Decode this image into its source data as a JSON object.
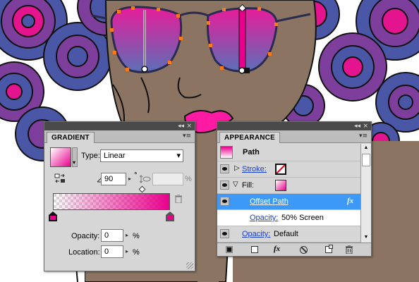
{
  "gradient_panel": {
    "tab_label": "GRADIENT",
    "type_label": "Type:",
    "type_value": "Linear",
    "angle_value": "90",
    "angle_unit": "°",
    "aspect_unit": "%",
    "opacity_label": "Opacity:",
    "opacity_value": "0",
    "opacity_unit": "%",
    "location_label": "Location:",
    "location_value": "0",
    "location_unit": "%",
    "gradient_start_color": "#ffffff",
    "gradient_end_color": "#e8008c",
    "collapse_glyph": "◂◂",
    "close_glyph": "×",
    "menu_glyph": "▾≡",
    "type_dropdown_glyph": "▾",
    "spin_glyph": "▸",
    "icons": [
      "gradient-swatch-icon",
      "reverse-gradient-icon",
      "angle-icon",
      "aspect-ratio-icon",
      "delete-stop-icon",
      "color-stop-icon",
      "midpoint-icon"
    ]
  },
  "appearance_panel": {
    "tab_label": "APPEARANCE",
    "path_label": "Path",
    "stroke_label": "Stroke:",
    "fill_label": "Fill:",
    "offset_path_label": "Offset Path",
    "fx_label": "fx",
    "opacity_link": "Opacity:",
    "opacity_value": "50% Screen",
    "bottom_opacity_link": "Opacity:",
    "bottom_opacity_value": "Default",
    "selected_color": "#3d99f5",
    "collapse_glyph": "◂◂",
    "close_glyph": "×",
    "menu_glyph": "▾≡",
    "footer_icons": [
      "new-art-icon",
      "add-stroke-icon",
      "add-fill-icon",
      "add-effect-icon",
      "clear-appearance-icon",
      "duplicate-item-icon",
      "delete-item-icon"
    ]
  },
  "artwork": {
    "skin_color": "#8b7462",
    "hair_colors": [
      "#4a56a6",
      "#7e3f9c",
      "#e3148d",
      "#2b2b52"
    ],
    "lips_color": "#ff1aa3",
    "lens_top_color": "#e81c9a",
    "lens_bottom_color": "#5b6fb8",
    "anchor_color": "#f47b20"
  }
}
